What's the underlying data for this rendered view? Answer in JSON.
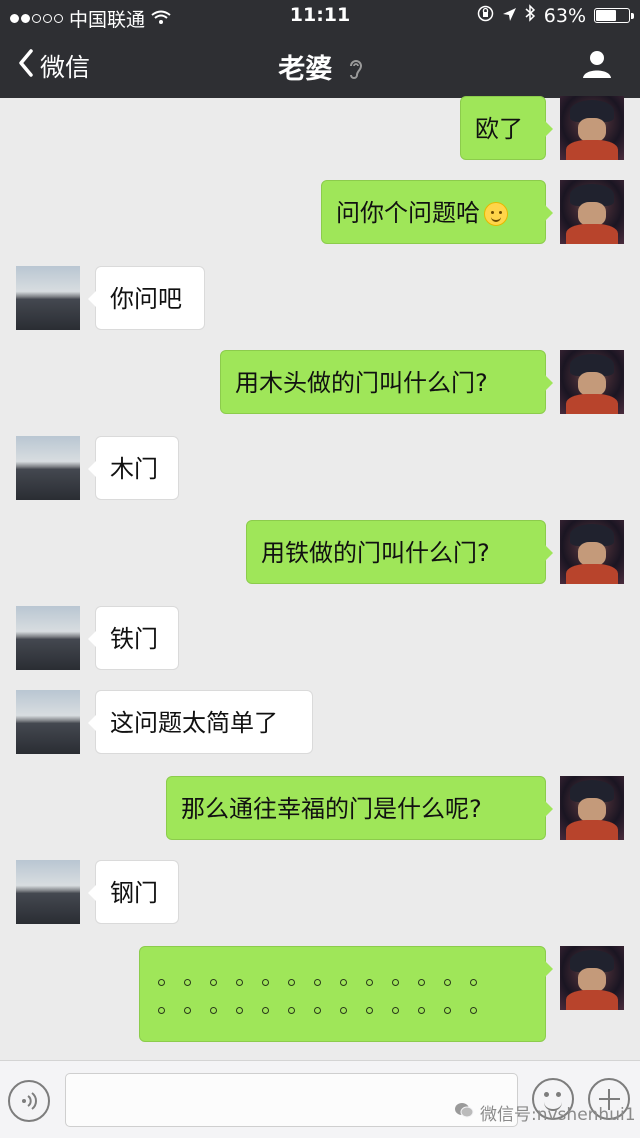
{
  "status_bar": {
    "carrier": "中国联通",
    "time": "11:11",
    "battery": "63%",
    "battery_level": 0.63,
    "signal_dots_filled": 2,
    "signal_dots_total": 5
  },
  "nav": {
    "back_label": "微信",
    "title": "老婆"
  },
  "messages": [
    {
      "from": "me",
      "text": "欧了"
    },
    {
      "from": "me",
      "text": "问你个问题哈",
      "emoji": "smile-emoji"
    },
    {
      "from": "her",
      "text": "你问吧"
    },
    {
      "from": "me",
      "text": "用木头做的门叫什么门?"
    },
    {
      "from": "her",
      "text": "木门"
    },
    {
      "from": "me",
      "text": "用铁做的门叫什么门?"
    },
    {
      "from": "her",
      "text": "铁门"
    },
    {
      "from": "her",
      "text": "这问题太简单了"
    },
    {
      "from": "me",
      "text": "那么通往幸福的门是什么呢?"
    },
    {
      "from": "her",
      "text": "钢门"
    },
    {
      "from": "me",
      "text": "。。。。。。。。。。。。。。。。。。。。。。。。。。"
    }
  ],
  "input_bar": {
    "input_value": ""
  },
  "watermark": "微信号:nvshenhui1",
  "colors": {
    "bar_bg": "#2e2f33",
    "chat_bg": "#ebebeb",
    "my_bubble": "#9fe659",
    "her_bubble": "#ffffff"
  }
}
